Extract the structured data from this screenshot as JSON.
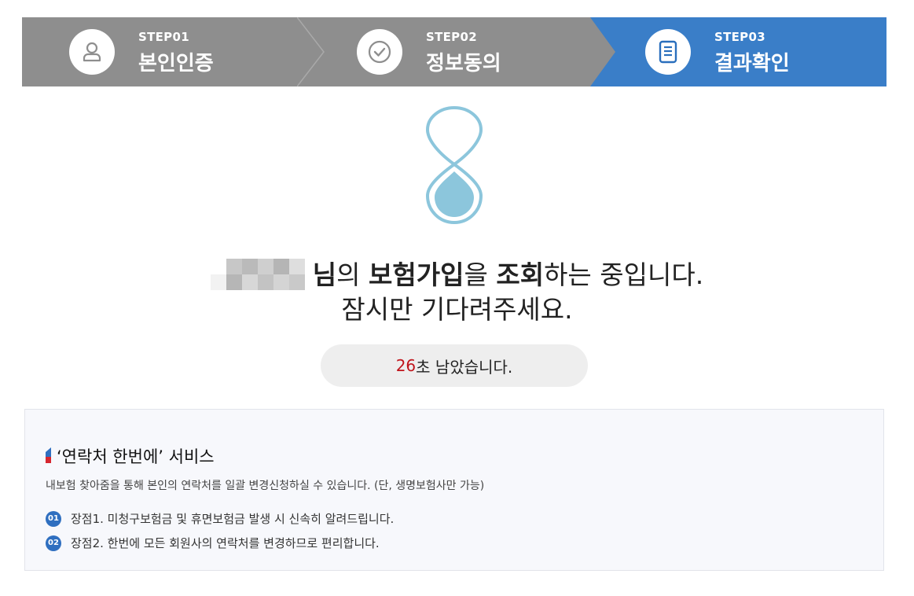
{
  "steps": [
    {
      "num": "STEP01",
      "title": "본인인증",
      "icon": "user-icon"
    },
    {
      "num": "STEP02",
      "title": "정보동의",
      "icon": "check-circle-icon"
    },
    {
      "num": "STEP03",
      "title": "결과확인",
      "icon": "document-icon"
    }
  ],
  "colors": {
    "step_inactive": "#8e8e8e",
    "step_active": "#3a7ec8",
    "accent_red": "#c0141b",
    "hourglass": "#8cc6dc"
  },
  "message": {
    "suffix_nim": "님",
    "part_ui": "의 ",
    "bold_insurance": "보험가입",
    "part_eul": "을 ",
    "bold_inquiry": "조회",
    "part_rest": "하는 중입니다.",
    "line2": "잠시만 기다려주세요."
  },
  "countdown": {
    "seconds": "26",
    "suffix": "초 남았습니다."
  },
  "info": {
    "title": "‘연락처 한번에’ 서비스",
    "desc": "내보험 찾아줌을 통해 본인의 연락처를 일괄 변경신청하실 수 있습니다. (단, 생명보험사만 가능)",
    "items": [
      {
        "badge": "01",
        "text": "장점1. 미청구보험금 및 휴면보험금 발생 시 신속히 알려드립니다."
      },
      {
        "badge": "02",
        "text": "장점2. 한번에 모든 회원사의 연락처를 변경하므로 편리합니다."
      }
    ]
  }
}
